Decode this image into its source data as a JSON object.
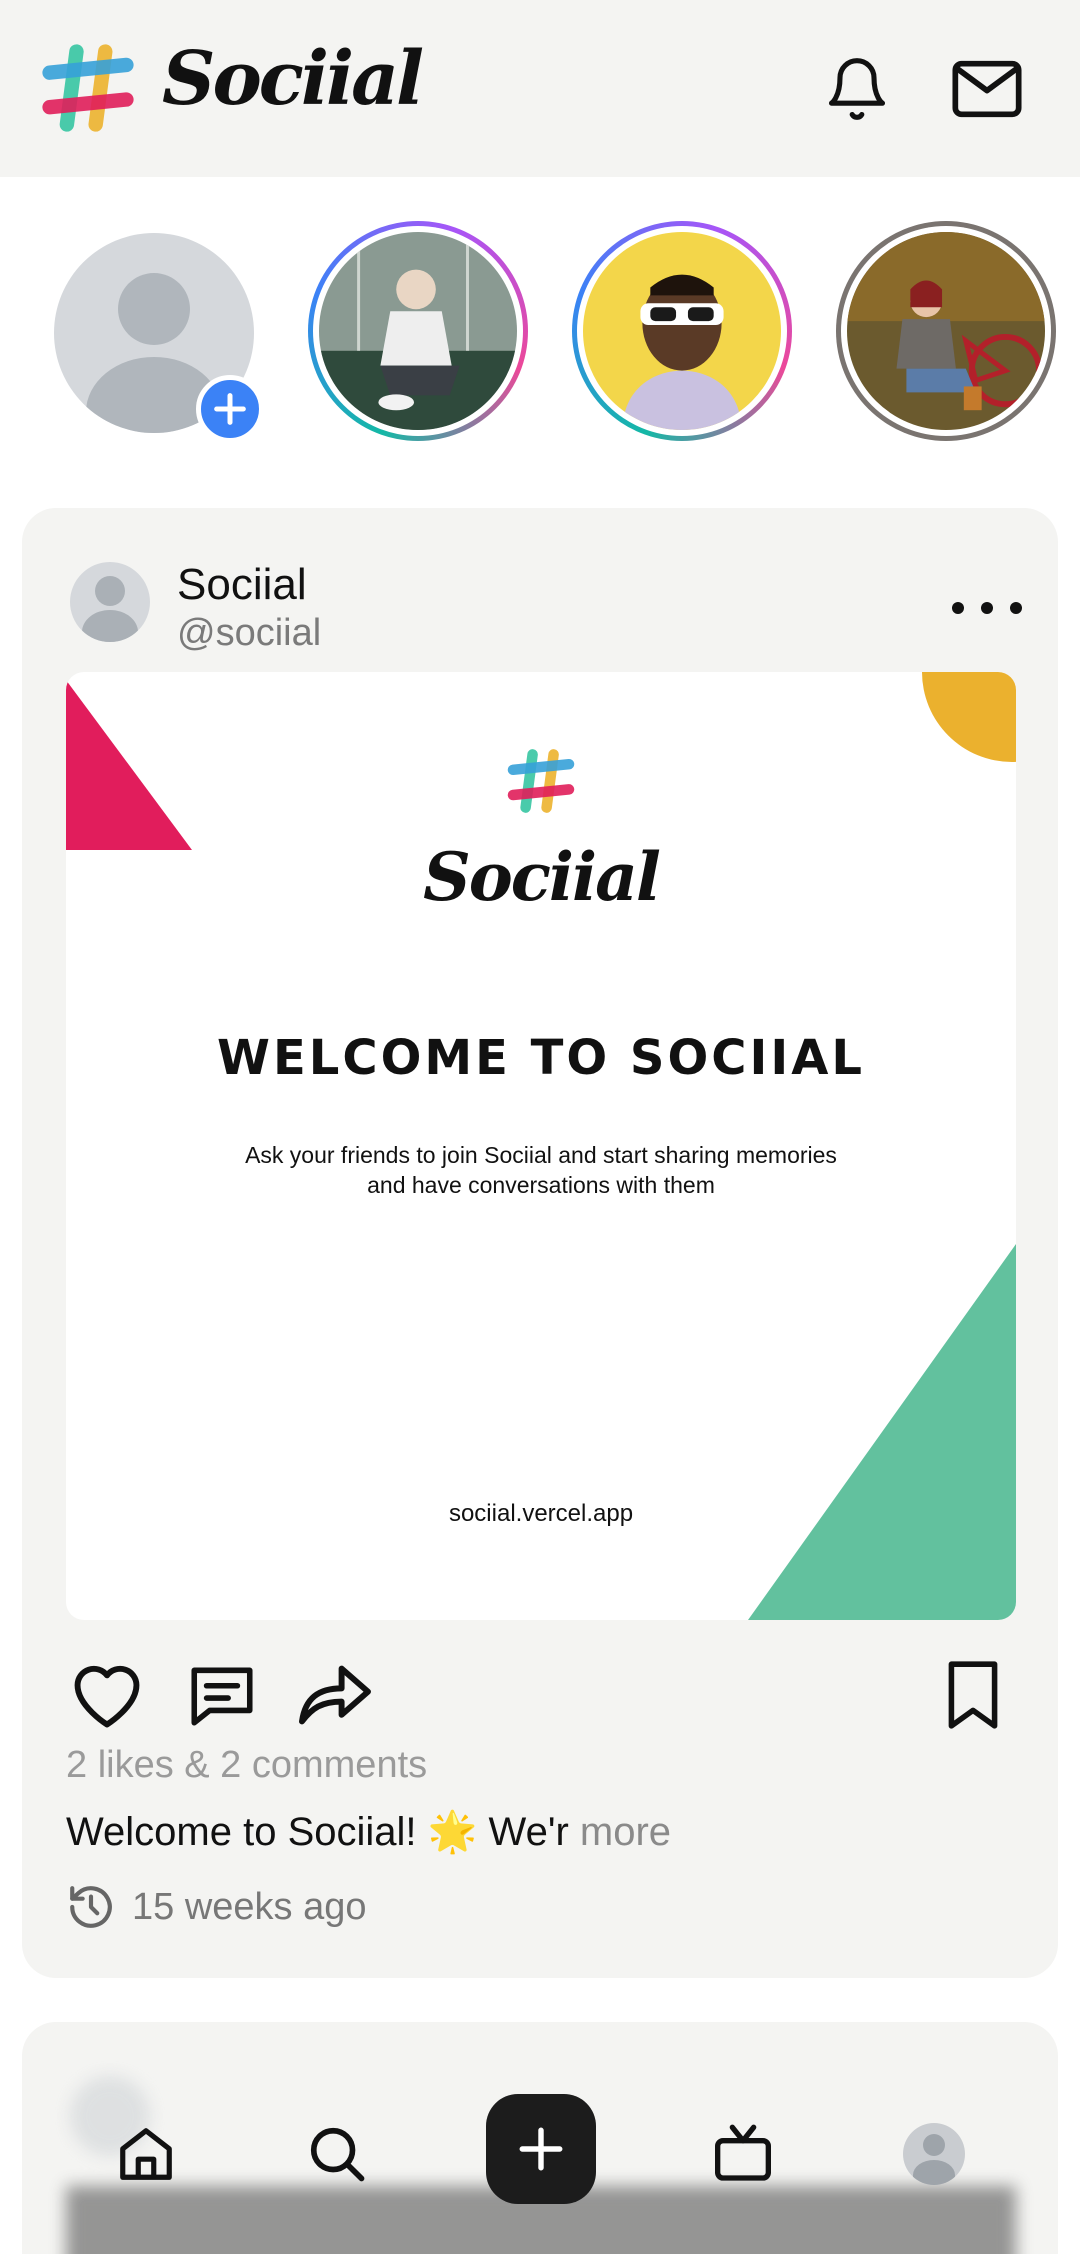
{
  "app": {
    "name": "Sociial",
    "brand_colors": {
      "teal": "#36C5A2",
      "red": "#E01E5A",
      "yellow": "#ECB22E",
      "blue": "#36A1D8"
    }
  },
  "header": {
    "logo_text": "Sociial",
    "icons": [
      "bell-icon",
      "mail-icon"
    ]
  },
  "stories": {
    "add_icon": "plus-icon",
    "items": [
      {
        "ring": "gradient"
      },
      {
        "ring": "gradient"
      },
      {
        "ring": "grey"
      }
    ]
  },
  "post": {
    "author_name": "Sociial",
    "author_handle": "@sociial",
    "menu_icon": "more-horizontal-icon",
    "image": {
      "brand": "Sociial",
      "headline": "WELCOME TO SOCIIAL",
      "description": "Ask your friends to join Sociial and start sharing memories and have conversations with them",
      "url": "sociial.vercel.app",
      "accent_colors": [
        "#E11D5C",
        "#EBB12E",
        "#62C19E"
      ]
    },
    "stats": "2 likes & 2 comments",
    "caption": "Welcome to Sociial! 🌟 We'r",
    "caption_more": "more",
    "time_ago": "15 weeks ago"
  },
  "nav": {
    "items": [
      "home-icon",
      "search-icon",
      "plus-icon",
      "tv-icon",
      "avatar"
    ]
  }
}
